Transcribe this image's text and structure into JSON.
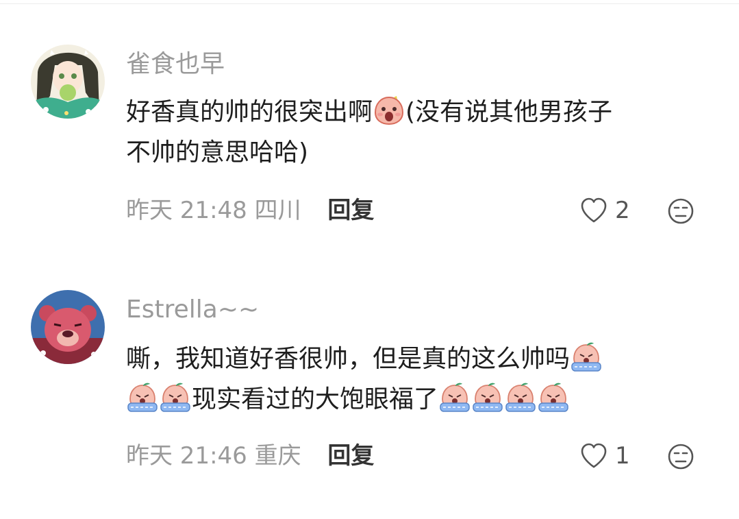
{
  "comments": [
    {
      "username": "雀食也早",
      "line1_text_a": "好香真的帅的很突出啊",
      "line1_text_b": "(没有说其他男孩子",
      "line2_text": "不帅的意思哈哈)",
      "time": "昨天 21:48",
      "location": "四川",
      "reply_label": "回复",
      "like_count": "2",
      "avatar_icon": "anime-girl-avatar",
      "emojis": [
        "shouting-emoji"
      ]
    },
    {
      "username": "Estrella~~",
      "line1_text": "嘶，我知道好香很帅，但是真的这么帅吗",
      "line2_text": "现实看过的大饱眼福了",
      "time": "昨天 21:46",
      "location": "重庆",
      "reply_label": "回复",
      "like_count": "1",
      "avatar_icon": "strawberry-bear-avatar",
      "emojis": [
        "crying-emoji",
        "crying-emoji",
        "crying-emoji",
        "crying-emoji",
        "crying-emoji",
        "crying-emoji",
        "crying-emoji"
      ]
    }
  ],
  "colors": {
    "username": "#9a9a9a",
    "text": "#1e1e1e",
    "meta": "#9a9a9a",
    "reply": "#333333",
    "icon": "#555555",
    "emoji_face": "#f7c1b4",
    "emoji_tears": "#8fb8f2",
    "emoji_leaf": "#3fa06a"
  }
}
